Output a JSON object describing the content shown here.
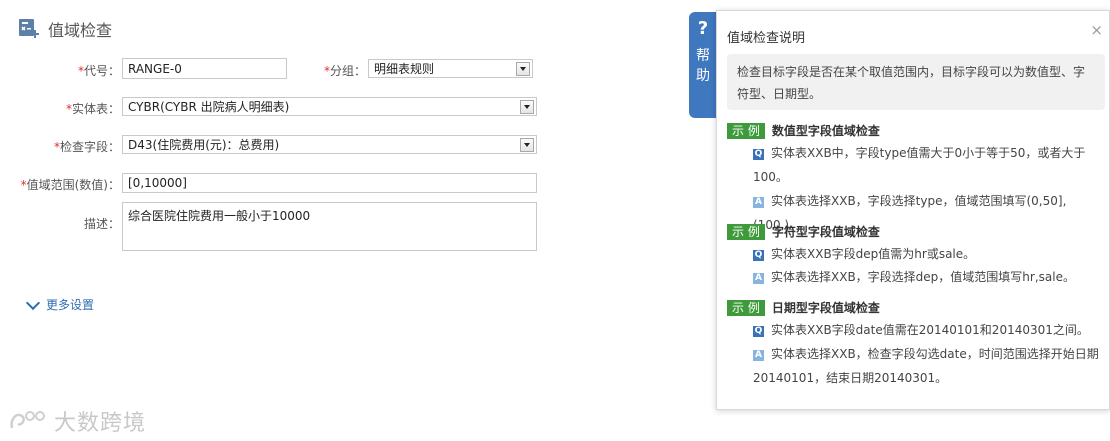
{
  "header": {
    "title": "值域检查"
  },
  "form": {
    "code_label": "代号：",
    "code_value": "RANGE-0",
    "group_label": "分组：",
    "group_value": "明细表规则",
    "entity_label": "实体表：",
    "entity_value": "CYBR(CYBR 出院病人明细表)",
    "field_label": "检查字段：",
    "field_value": "D43(住院费用(元)：总费用)",
    "range_label": "值域范围(数值)：",
    "range_value": "[0,10000]",
    "desc_label": "描述：",
    "desc_value": "综合医院住院费用一般小于10000",
    "required_mark": "*",
    "more_settings": "更多设置"
  },
  "help": {
    "tab_q": "?",
    "tab_text": "帮助",
    "title": "值域检查说明",
    "close": "×",
    "description": "检查目标字段是否在某个取值范围内，目标字段可以为数值型、字符型、日期型。",
    "badge": "示 例",
    "q_icon": "Q",
    "a_icon": "A",
    "sections": [
      {
        "title": "数值型字段值域检查",
        "q": "实体表XXB中，字段type值需大于0小于等于50，或者大于100。",
        "a": "实体表选择XXB，字段选择type，值域范围填写(0,50],(100,)。"
      },
      {
        "title": "字符型字段值域检查",
        "q": "实体表XXB字段dep值需为hr或sale。",
        "a": "实体表选择XXB，字段选择dep，值域范围填写hr,sale。"
      },
      {
        "title": "日期型字段值域检查",
        "q": "实体表XXB字段date值需在20140101和20140301之间。",
        "a": "实体表选择XXB，检查字段勾选date，时间范围选择开始日期20140101，结束日期20140301。"
      }
    ]
  },
  "watermark": "大数跨境"
}
